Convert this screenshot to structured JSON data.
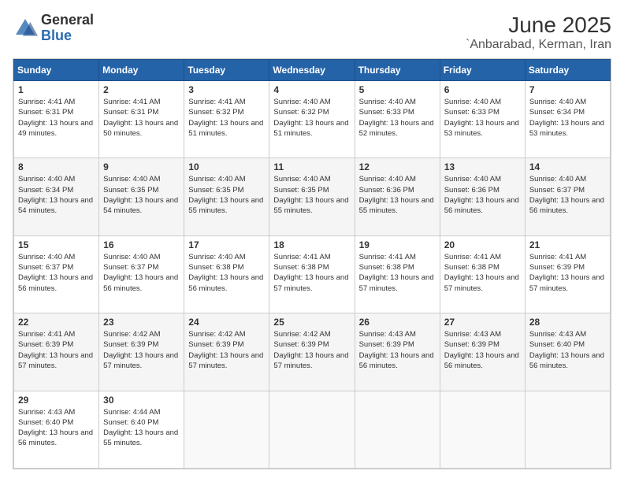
{
  "header": {
    "logo_general": "General",
    "logo_blue": "Blue",
    "title": "June 2025",
    "subtitle": "`Anbarabad, Kerman, Iran"
  },
  "calendar": {
    "days_of_week": [
      "Sunday",
      "Monday",
      "Tuesday",
      "Wednesday",
      "Thursday",
      "Friday",
      "Saturday"
    ],
    "weeks": [
      [
        null,
        {
          "day": 2,
          "sunrise": "Sunrise: 4:41 AM",
          "sunset": "Sunset: 6:31 PM",
          "daylight": "Daylight: 13 hours and 50 minutes."
        },
        {
          "day": 3,
          "sunrise": "Sunrise: 4:41 AM",
          "sunset": "Sunset: 6:32 PM",
          "daylight": "Daylight: 13 hours and 51 minutes."
        },
        {
          "day": 4,
          "sunrise": "Sunrise: 4:40 AM",
          "sunset": "Sunset: 6:32 PM",
          "daylight": "Daylight: 13 hours and 51 minutes."
        },
        {
          "day": 5,
          "sunrise": "Sunrise: 4:40 AM",
          "sunset": "Sunset: 6:33 PM",
          "daylight": "Daylight: 13 hours and 52 minutes."
        },
        {
          "day": 6,
          "sunrise": "Sunrise: 4:40 AM",
          "sunset": "Sunset: 6:33 PM",
          "daylight": "Daylight: 13 hours and 53 minutes."
        },
        {
          "day": 7,
          "sunrise": "Sunrise: 4:40 AM",
          "sunset": "Sunset: 6:34 PM",
          "daylight": "Daylight: 13 hours and 53 minutes."
        }
      ],
      [
        {
          "day": 1,
          "sunrise": "Sunrise: 4:41 AM",
          "sunset": "Sunset: 6:31 PM",
          "daylight": "Daylight: 13 hours and 49 minutes."
        },
        null,
        null,
        null,
        null,
        null,
        null
      ],
      [
        {
          "day": 8,
          "sunrise": "Sunrise: 4:40 AM",
          "sunset": "Sunset: 6:34 PM",
          "daylight": "Daylight: 13 hours and 54 minutes."
        },
        {
          "day": 9,
          "sunrise": "Sunrise: 4:40 AM",
          "sunset": "Sunset: 6:35 PM",
          "daylight": "Daylight: 13 hours and 54 minutes."
        },
        {
          "day": 10,
          "sunrise": "Sunrise: 4:40 AM",
          "sunset": "Sunset: 6:35 PM",
          "daylight": "Daylight: 13 hours and 55 minutes."
        },
        {
          "day": 11,
          "sunrise": "Sunrise: 4:40 AM",
          "sunset": "Sunset: 6:35 PM",
          "daylight": "Daylight: 13 hours and 55 minutes."
        },
        {
          "day": 12,
          "sunrise": "Sunrise: 4:40 AM",
          "sunset": "Sunset: 6:36 PM",
          "daylight": "Daylight: 13 hours and 55 minutes."
        },
        {
          "day": 13,
          "sunrise": "Sunrise: 4:40 AM",
          "sunset": "Sunset: 6:36 PM",
          "daylight": "Daylight: 13 hours and 56 minutes."
        },
        {
          "day": 14,
          "sunrise": "Sunrise: 4:40 AM",
          "sunset": "Sunset: 6:37 PM",
          "daylight": "Daylight: 13 hours and 56 minutes."
        }
      ],
      [
        {
          "day": 15,
          "sunrise": "Sunrise: 4:40 AM",
          "sunset": "Sunset: 6:37 PM",
          "daylight": "Daylight: 13 hours and 56 minutes."
        },
        {
          "day": 16,
          "sunrise": "Sunrise: 4:40 AM",
          "sunset": "Sunset: 6:37 PM",
          "daylight": "Daylight: 13 hours and 56 minutes."
        },
        {
          "day": 17,
          "sunrise": "Sunrise: 4:40 AM",
          "sunset": "Sunset: 6:38 PM",
          "daylight": "Daylight: 13 hours and 56 minutes."
        },
        {
          "day": 18,
          "sunrise": "Sunrise: 4:41 AM",
          "sunset": "Sunset: 6:38 PM",
          "daylight": "Daylight: 13 hours and 57 minutes."
        },
        {
          "day": 19,
          "sunrise": "Sunrise: 4:41 AM",
          "sunset": "Sunset: 6:38 PM",
          "daylight": "Daylight: 13 hours and 57 minutes."
        },
        {
          "day": 20,
          "sunrise": "Sunrise: 4:41 AM",
          "sunset": "Sunset: 6:38 PM",
          "daylight": "Daylight: 13 hours and 57 minutes."
        },
        {
          "day": 21,
          "sunrise": "Sunrise: 4:41 AM",
          "sunset": "Sunset: 6:39 PM",
          "daylight": "Daylight: 13 hours and 57 minutes."
        }
      ],
      [
        {
          "day": 22,
          "sunrise": "Sunrise: 4:41 AM",
          "sunset": "Sunset: 6:39 PM",
          "daylight": "Daylight: 13 hours and 57 minutes."
        },
        {
          "day": 23,
          "sunrise": "Sunrise: 4:42 AM",
          "sunset": "Sunset: 6:39 PM",
          "daylight": "Daylight: 13 hours and 57 minutes."
        },
        {
          "day": 24,
          "sunrise": "Sunrise: 4:42 AM",
          "sunset": "Sunset: 6:39 PM",
          "daylight": "Daylight: 13 hours and 57 minutes."
        },
        {
          "day": 25,
          "sunrise": "Sunrise: 4:42 AM",
          "sunset": "Sunset: 6:39 PM",
          "daylight": "Daylight: 13 hours and 57 minutes."
        },
        {
          "day": 26,
          "sunrise": "Sunrise: 4:43 AM",
          "sunset": "Sunset: 6:39 PM",
          "daylight": "Daylight: 13 hours and 56 minutes."
        },
        {
          "day": 27,
          "sunrise": "Sunrise: 4:43 AM",
          "sunset": "Sunset: 6:39 PM",
          "daylight": "Daylight: 13 hours and 56 minutes."
        },
        {
          "day": 28,
          "sunrise": "Sunrise: 4:43 AM",
          "sunset": "Sunset: 6:40 PM",
          "daylight": "Daylight: 13 hours and 56 minutes."
        }
      ],
      [
        {
          "day": 29,
          "sunrise": "Sunrise: 4:43 AM",
          "sunset": "Sunset: 6:40 PM",
          "daylight": "Daylight: 13 hours and 56 minutes."
        },
        {
          "day": 30,
          "sunrise": "Sunrise: 4:44 AM",
          "sunset": "Sunset: 6:40 PM",
          "daylight": "Daylight: 13 hours and 55 minutes."
        },
        null,
        null,
        null,
        null,
        null
      ]
    ]
  }
}
